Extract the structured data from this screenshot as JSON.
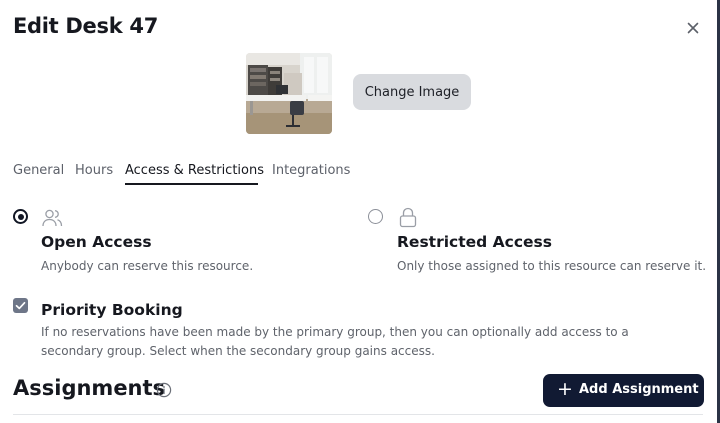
{
  "modal": {
    "title": "Edit Desk 47",
    "close_icon": "close-icon"
  },
  "image": {
    "change_label": "Change Image"
  },
  "tabs": [
    {
      "label": "General",
      "active": false
    },
    {
      "label": "Hours",
      "active": false
    },
    {
      "label": "Access & Restrictions",
      "active": true
    },
    {
      "label": "Integrations",
      "active": false
    }
  ],
  "access": {
    "open": {
      "title": "Open Access",
      "description": "Anybody can reserve this resource.",
      "selected": true,
      "icon": "users-icon"
    },
    "restricted": {
      "title": "Restricted Access",
      "description": "Only those assigned to this resource can reserve it.",
      "selected": false,
      "icon": "lock-icon"
    }
  },
  "priority_booking": {
    "title": "Priority Booking",
    "checked": true,
    "description": "If no reservations have been made by the primary group, then you can optionally add access to a secondary group. Select when the secondary group gains access."
  },
  "assignments": {
    "title": "Assignments",
    "info_icon": "info-icon",
    "add_label": "Add Assignment",
    "add_icon": "plus-icon"
  },
  "colors": {
    "primary_button": "#111a33",
    "secondary_button": "#d9dbdf",
    "text": "#16181f",
    "muted_text": "#5f636b"
  }
}
